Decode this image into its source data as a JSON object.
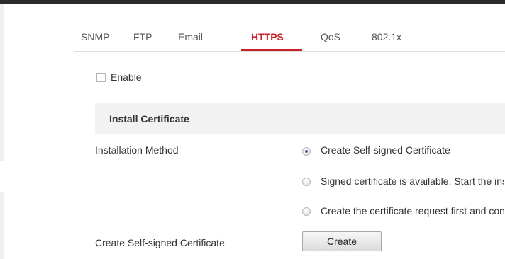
{
  "tabs": [
    {
      "label": "SNMP"
    },
    {
      "label": "FTP"
    },
    {
      "label": "Email"
    },
    {
      "label": "HTTPS",
      "active": true
    },
    {
      "label": "QoS"
    },
    {
      "label": "802.1x"
    }
  ],
  "enable": {
    "label": "Enable",
    "checked": false
  },
  "section": {
    "title": "Install Certificate"
  },
  "installation_method": {
    "label": "Installation Method",
    "options": [
      {
        "label": "Create Self-signed Certificate",
        "selected": true
      },
      {
        "label": "Signed certificate is available, Start the installation directly.",
        "selected": false
      },
      {
        "label": "Create the certificate request first and continue the installation.",
        "selected": false
      }
    ]
  },
  "self_signed": {
    "label": "Create Self-signed Certificate",
    "button_label": "Create"
  },
  "colors": {
    "accent": "#c8202a",
    "topbar": "#2b2b2b",
    "section_bg": "#f2f2f2"
  }
}
